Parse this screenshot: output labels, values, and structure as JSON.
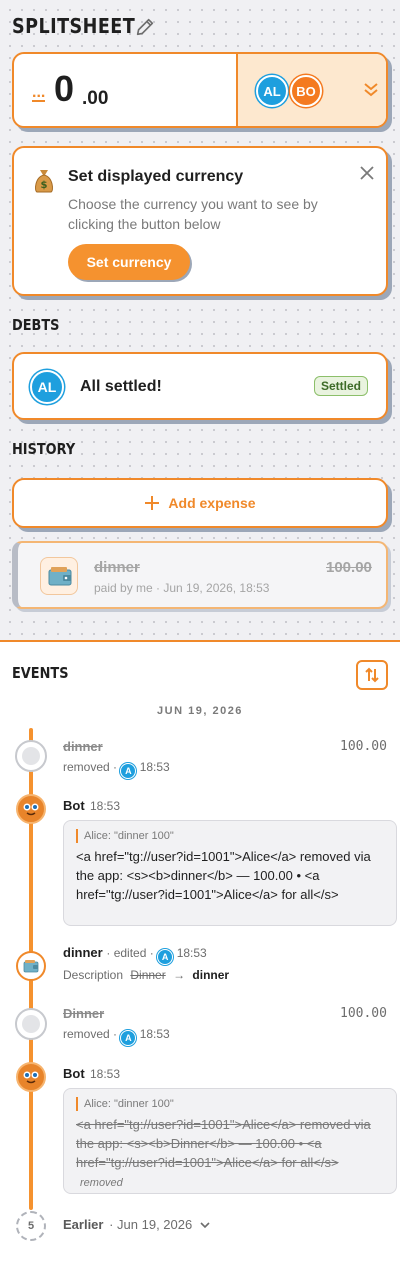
{
  "app": {
    "title": "SPLITSHEET"
  },
  "balance": {
    "dots": "...",
    "whole": "0",
    "cents": ".00"
  },
  "members": [
    {
      "initials": "AL",
      "color": "#1e9fde"
    },
    {
      "initials": "BO",
      "color": "#f47a20"
    }
  ],
  "currency_card": {
    "title": "Set displayed currency",
    "description": "Choose the currency you want to see by clicking the button below",
    "button": "Set currency"
  },
  "debts": {
    "heading": "DEBTS",
    "avatar": "AL",
    "text": "All settled!",
    "badge": "Settled"
  },
  "history": {
    "heading": "HISTORY",
    "add_button": "Add expense",
    "items": [
      {
        "name": "dinner",
        "meta": "paid by me · Jun 19, 2026, 18:53",
        "amount": "100.00"
      }
    ]
  },
  "events": {
    "heading": "EVENTS",
    "date": "JUN 19, 2026",
    "items": [
      {
        "title": "dinner",
        "action": "removed",
        "user_initial": "A",
        "time": "18:53",
        "amount": "100.00"
      },
      {
        "author": "Bot",
        "time": "18:53",
        "quote": "Alice: \"dinner 100\"",
        "body": "<a href=\"tg://user?id=1001\">Alice</a> removed via the app: <s><b>dinner</b> — 100.00 • <a href=\"tg://user?id=1001\">Alice</a> for all</s>"
      },
      {
        "title": "dinner",
        "action": "edited",
        "user_initial": "A",
        "time": "18:53",
        "change_label": "Description",
        "old": "Dinner",
        "arrow": "→",
        "new": "dinner"
      },
      {
        "title": "Dinner",
        "action": "removed",
        "user_initial": "A",
        "time": "18:53",
        "amount": "100.00"
      },
      {
        "author": "Bot",
        "time": "18:53",
        "quote": "Alice: \"dinner 100\"",
        "body": "<a href=\"tg://user?id=1001\">Alice</a> removed via the app: <s><b>Dinner</b> — 100.00 • <a href=\"tg://user?id=1001\">Alice</a> for all</s>",
        "status": "removed"
      }
    ],
    "earlier": {
      "count": "5",
      "label": "Earlier",
      "date": "· Jun 19, 2026"
    }
  },
  "colors": {
    "accent": "#f0892a",
    "accent_fill": "#f5922f",
    "panel_bg": "#fde8cf",
    "settled_green": "#8cbf6a"
  }
}
